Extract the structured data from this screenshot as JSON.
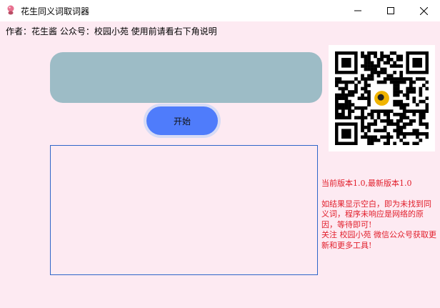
{
  "window": {
    "title": "花生同义词取词器",
    "icon": "peanut-app-icon",
    "controls": [
      "minimize-icon",
      "maximize-icon",
      "close-icon"
    ]
  },
  "header": {
    "author_line": "作者：花生酱 公众号：校园小苑 使用前请看右下角说明"
  },
  "main": {
    "display_text": "",
    "start_button_label": "开始",
    "result_text": ""
  },
  "sidebar": {
    "qr_code": "qr-code-image",
    "version_line": "当前版本1.0,最新版本1.0",
    "notice_lines": [
      "如结果显示空白，即为未找到同义词，程序未响应是网络的原因，等待即可!",
      "关注 校园小苑 微信公众号获取更新和更多工具!"
    ]
  },
  "colors": {
    "background": "#fdeaf2",
    "display_box": "#9dbcc6",
    "button": "#4f7cfb",
    "result_border": "#2f66c9",
    "notice_text": "#e11d2a"
  }
}
